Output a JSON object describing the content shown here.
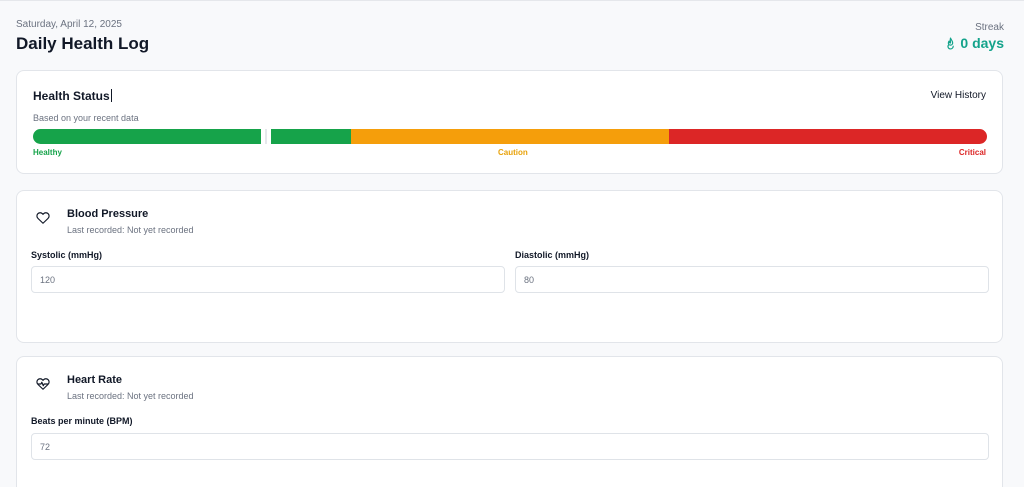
{
  "header": {
    "date": "Saturday, April 12, 2025",
    "title": "Daily Health Log",
    "streak_label": "Streak",
    "streak_value": "0 days",
    "streak_icon": "flame-icon"
  },
  "status": {
    "title": "Health Status",
    "subtitle": "Based on your recent data",
    "view_history": "View History",
    "level_fraction": 0.244,
    "segments": [
      {
        "label": "Healthy",
        "color": "#16a34a"
      },
      {
        "label": "Caution",
        "color": "#f59e0b"
      },
      {
        "label": "Critical",
        "color": "#dc2626"
      }
    ]
  },
  "blood_pressure": {
    "icon": "heart-icon",
    "title": "Blood Pressure",
    "last_recorded": "Last recorded: Not yet recorded",
    "systolic_label": "Systolic (mmHg)",
    "systolic_placeholder": "120",
    "diastolic_label": "Diastolic (mmHg)",
    "diastolic_placeholder": "80"
  },
  "heart_rate": {
    "icon": "heart-pulse-icon",
    "title": "Heart Rate",
    "last_recorded": "Last recorded: Not yet recorded",
    "bpm_label": "Beats per minute (BPM)",
    "bpm_placeholder": "72"
  },
  "colors": {
    "accent": "#14a38b",
    "healthy": "#16a34a",
    "caution": "#f59e0b",
    "critical": "#dc2626"
  }
}
